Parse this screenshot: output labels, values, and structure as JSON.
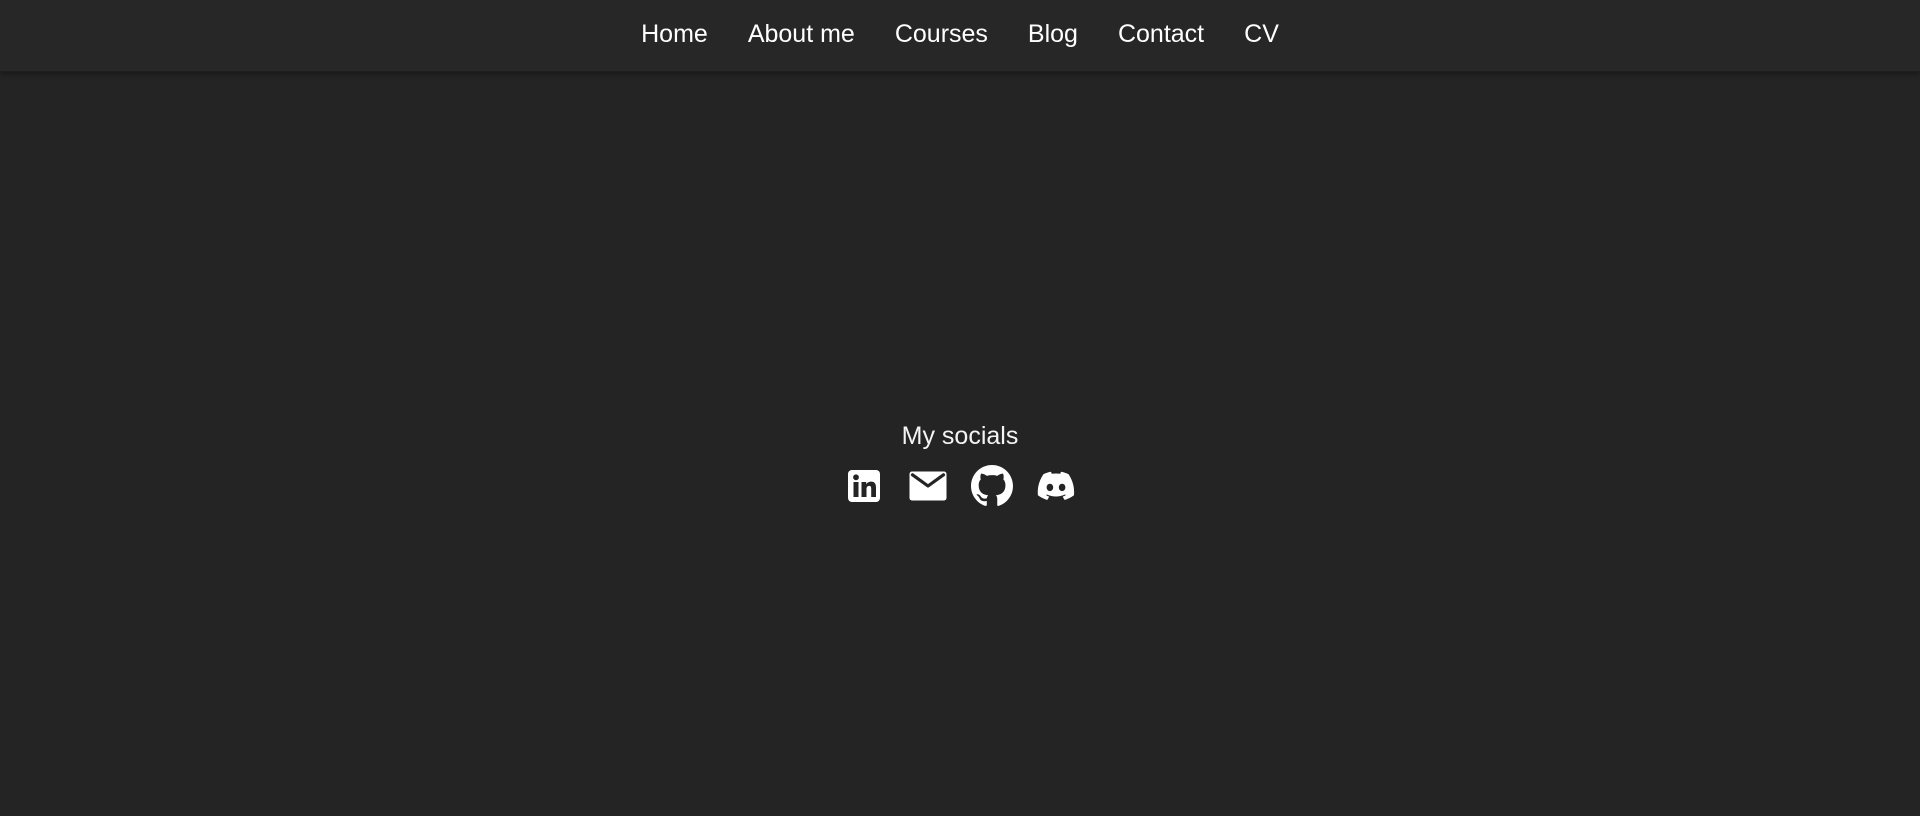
{
  "nav": {
    "items": [
      {
        "label": "Home"
      },
      {
        "label": "About me"
      },
      {
        "label": "Courses"
      },
      {
        "label": "Blog"
      },
      {
        "label": "Contact"
      },
      {
        "label": "CV"
      }
    ]
  },
  "socials": {
    "heading": "My socials",
    "links": [
      {
        "icon": "linkedin-icon"
      },
      {
        "icon": "mail-icon"
      },
      {
        "icon": "github-icon"
      },
      {
        "icon": "discord-icon"
      }
    ]
  },
  "colors": {
    "background": "#242424",
    "nav_background": "#272727",
    "text": "#ffffff"
  }
}
